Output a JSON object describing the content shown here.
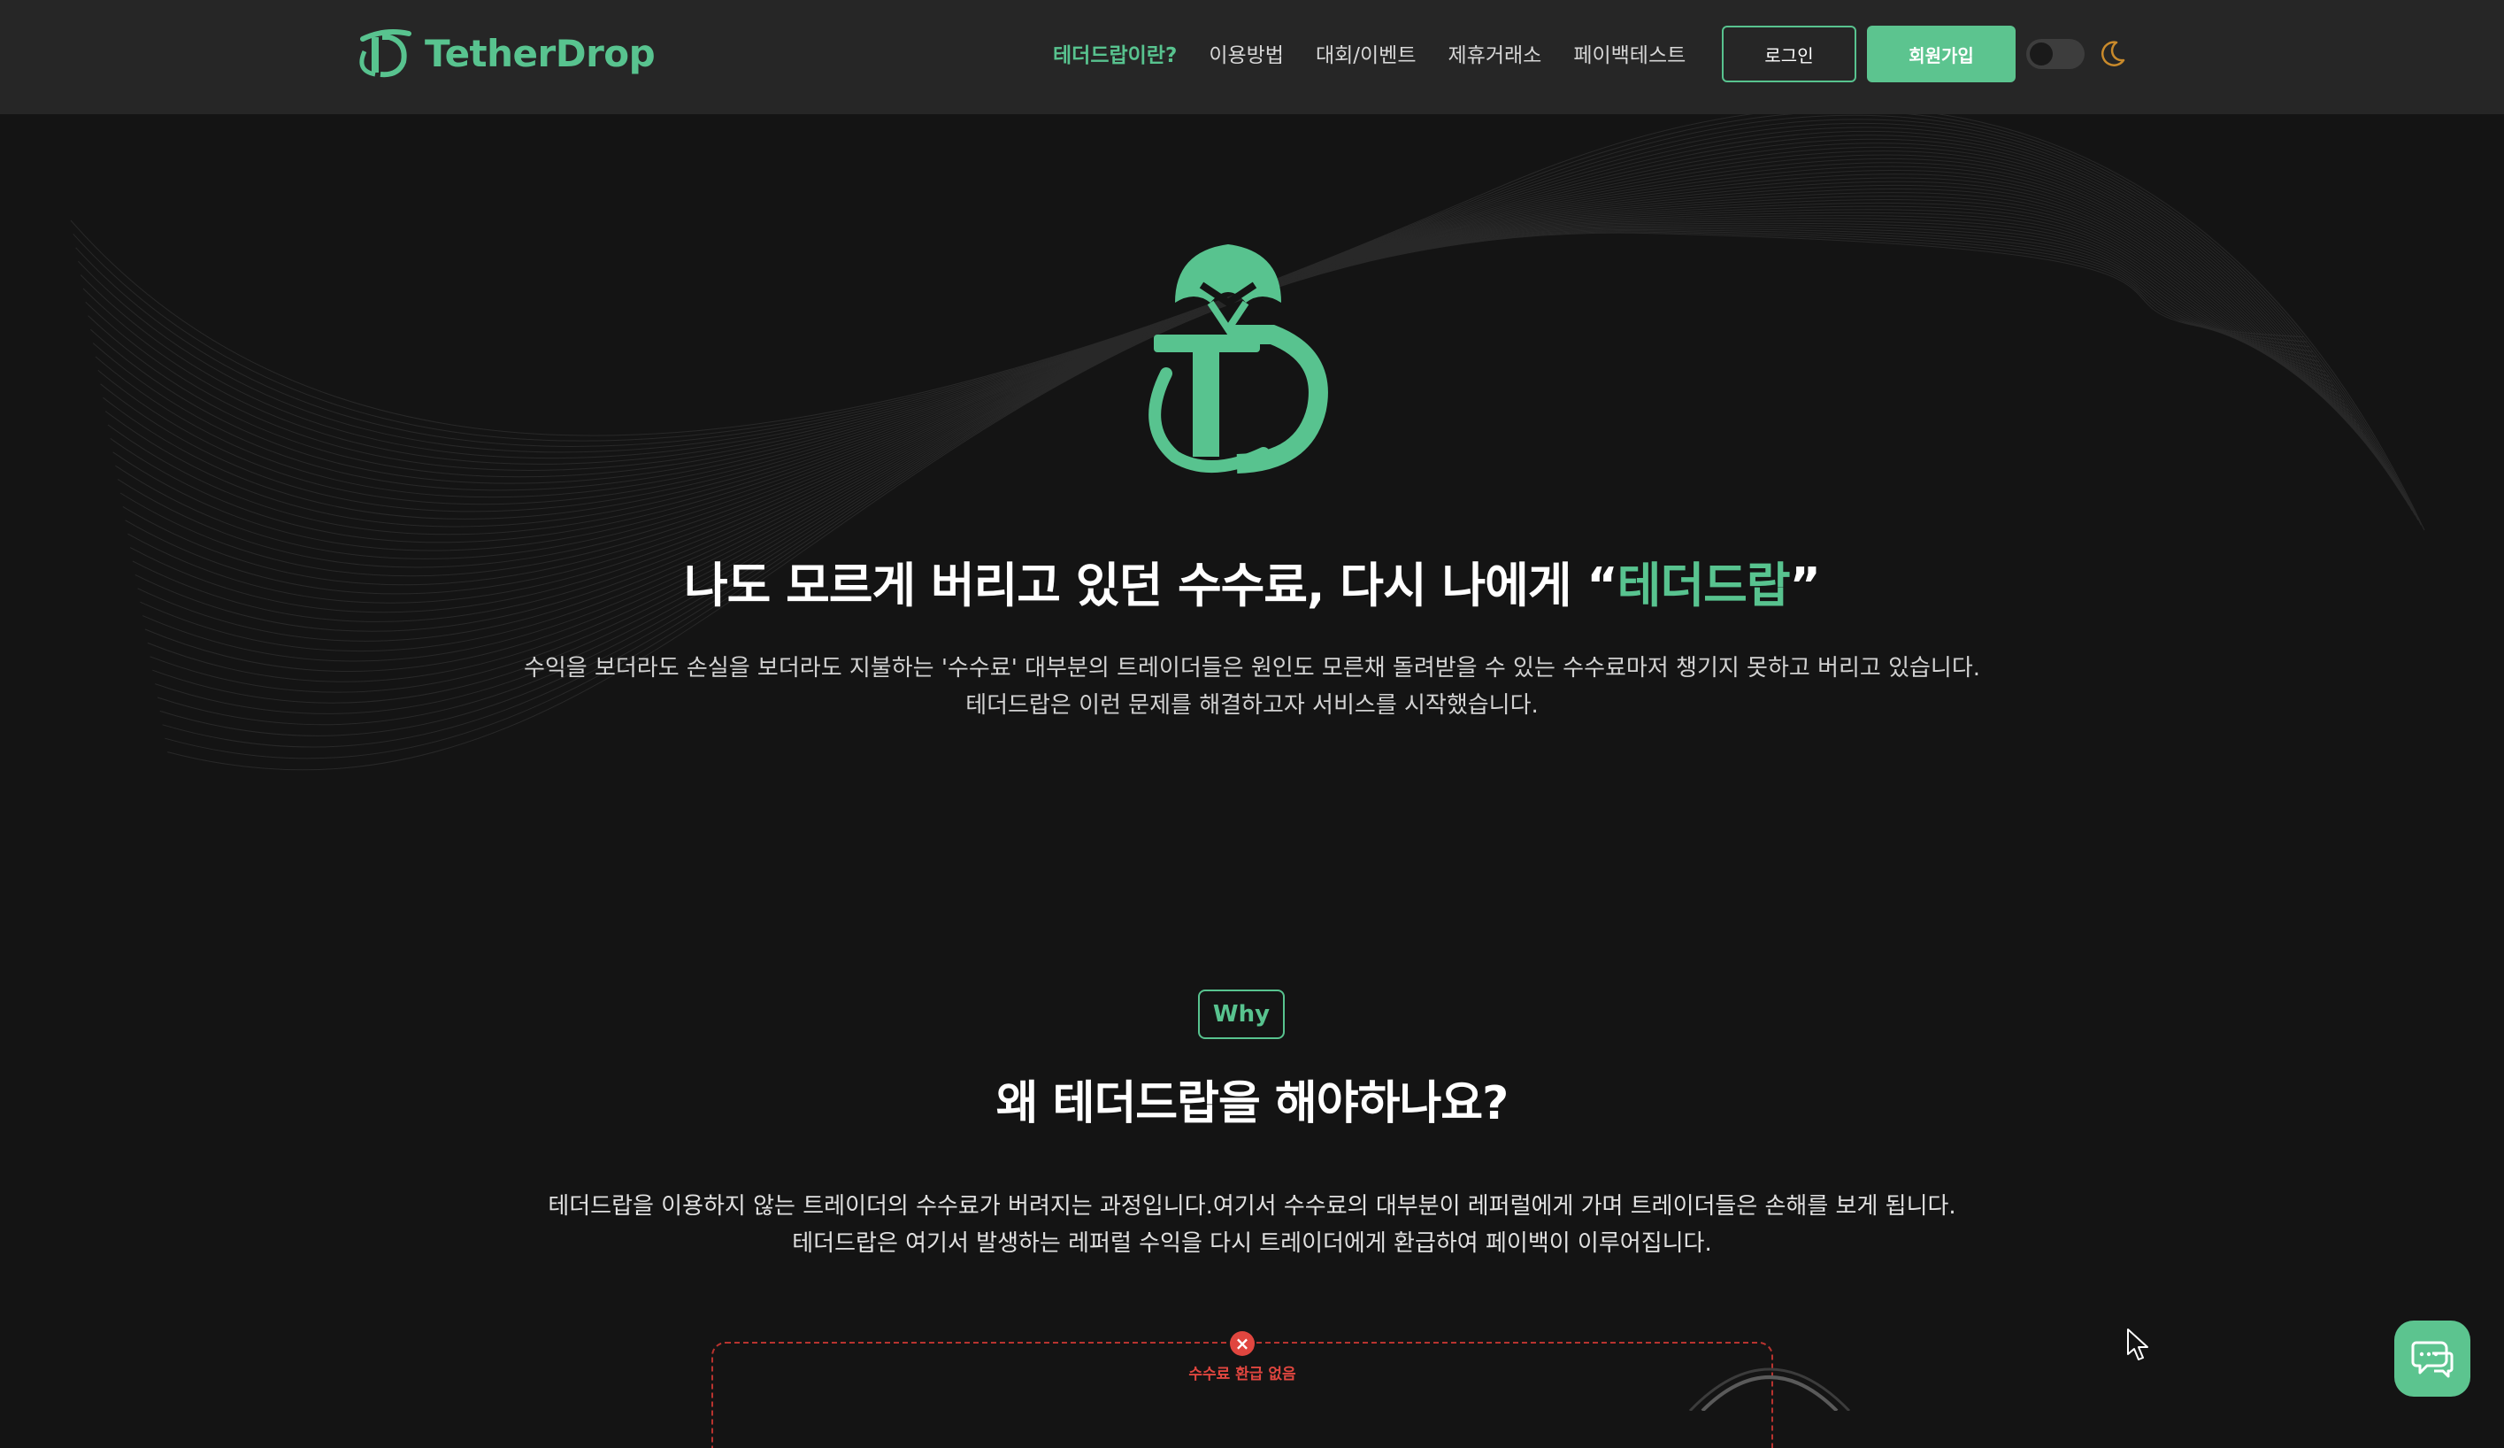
{
  "brand": {
    "name": "TetherDrop",
    "color": "#58c38f"
  },
  "nav": {
    "items": [
      {
        "label": "테더드랍이란?",
        "active": true
      },
      {
        "label": "이용방법",
        "active": false
      },
      {
        "label": "대회/이벤트",
        "active": false
      },
      {
        "label": "제휴거래소",
        "active": false
      },
      {
        "label": "페이백테스트",
        "active": false
      }
    ],
    "login_label": "로그인",
    "signup_label": "회원가입",
    "theme_toggle": {
      "state": "off",
      "icon": "moon-icon"
    }
  },
  "hero": {
    "title_prefix": "나도 모르게 버리고 있던 수수료, 다시 나에게 “",
    "title_accent": "테더드랍",
    "title_suffix": "”",
    "desc_line1": "수익을 보더라도 손실을 보더라도 지불하는 '수수료' 대부분의 트레이더들은 원인도 모른채 돌려받을 수 있는 수수료마저 챙기지 못하고 버리고 있습니다.",
    "desc_line2": "테더드랍은 이런 문제를 해결하고자 서비스를 시작했습니다."
  },
  "why": {
    "badge": "Why",
    "title": "왜 테더드랍을 해야하나요?",
    "desc_line1": "테더드랍을 이용하지 않는 트레이더의 수수료가 버려지는 과정입니다.여기서 수수료의 대부분이 레퍼럴에게 가며 트레이더들은 손해를 보게 됩니다.",
    "desc_line2": "테더드랍은 여기서 발생하는 레퍼럴 수익을 다시 트레이더에게 환급하여 페이백이 이루어집니다.",
    "diagram_label": "수수료 환급 없음",
    "diagram_icon": "x-icon"
  },
  "chat": {
    "icon": "chat-icon"
  }
}
